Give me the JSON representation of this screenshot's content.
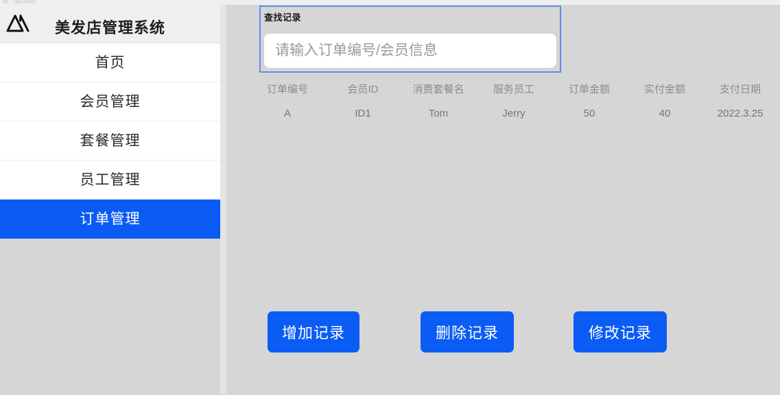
{
  "app": {
    "title": "美发店管理系统",
    "logo_icon": "mountain-logo-icon",
    "accent_color": "#0a5cf5",
    "background_color": "#d6d6d6"
  },
  "artifact": {
    "left_text": "设置",
    "right_text": "美发店管理系统"
  },
  "sidebar": {
    "items": [
      {
        "label": "首页",
        "active": false
      },
      {
        "label": "会员管理",
        "active": false
      },
      {
        "label": "套餐管理",
        "active": false
      },
      {
        "label": "员工管理",
        "active": false
      },
      {
        "label": "订单管理",
        "active": true
      }
    ]
  },
  "search": {
    "panel_label": "查找记录",
    "placeholder": "请输入订单编号/会员信息",
    "value": ""
  },
  "table": {
    "headers": [
      "订单编号",
      "会员ID",
      "消费套餐名",
      "服务员工",
      "订单金额",
      "实付金额",
      "支付日期"
    ],
    "rows": [
      [
        "A",
        "ID1",
        "Tom",
        "Jerry",
        "50",
        "40",
        "2022.3.25"
      ]
    ]
  },
  "actions": {
    "buttons": [
      {
        "label": "增加记录"
      },
      {
        "label": "删除记录"
      },
      {
        "label": "修改记录"
      }
    ]
  }
}
